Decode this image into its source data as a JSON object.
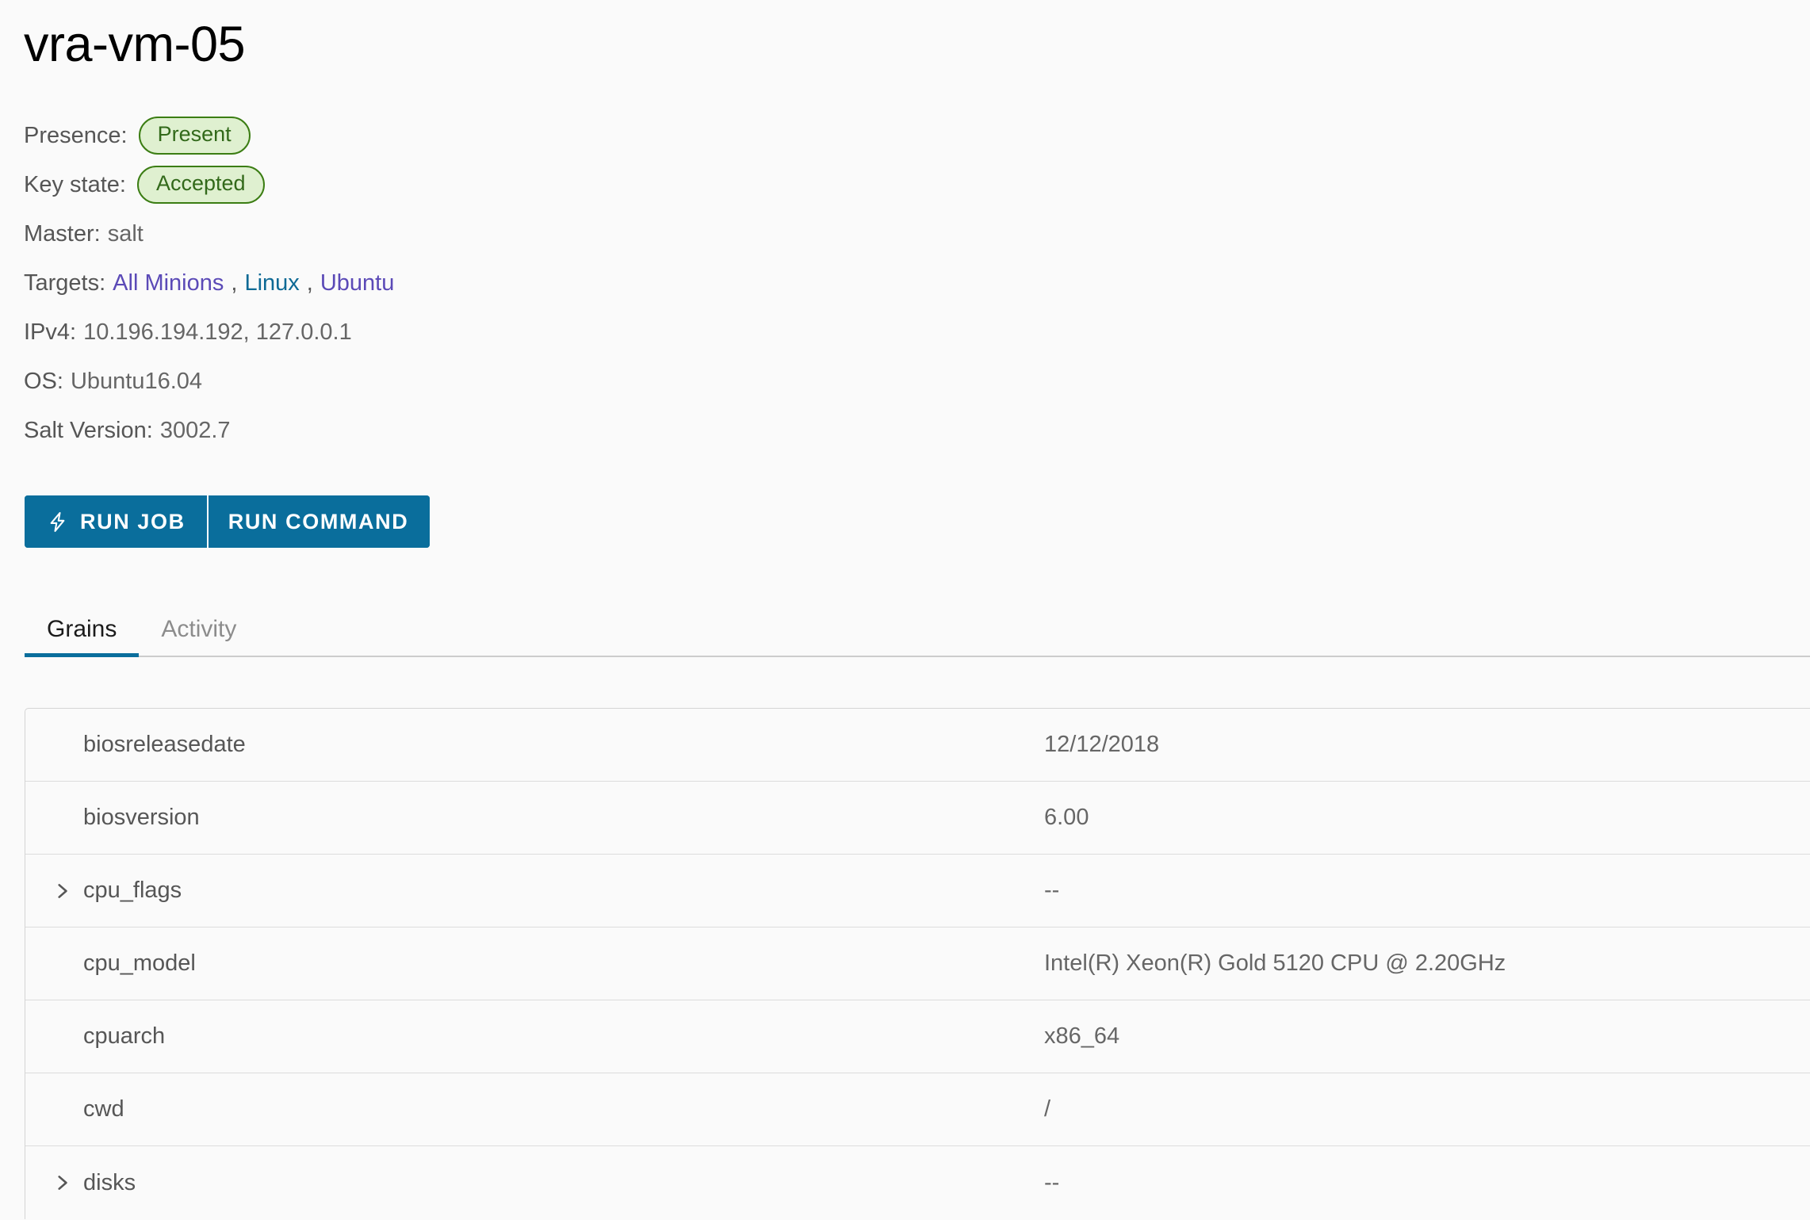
{
  "header": {
    "title": "vra-vm-05"
  },
  "meta": {
    "presence": {
      "label": "Presence:",
      "value": "Present"
    },
    "key_state": {
      "label": "Key state:",
      "value": "Accepted"
    },
    "master": {
      "label": "Master:",
      "value": "salt"
    },
    "targets": {
      "label": "Targets:",
      "items": [
        "All Minions",
        "Linux",
        "Ubuntu"
      ],
      "separator": ","
    },
    "ipv4": {
      "label": "IPv4:",
      "value": "10.196.194.192, 127.0.0.1"
    },
    "os": {
      "label": "OS:",
      "value": "Ubuntu16.04"
    },
    "salt_version": {
      "label": "Salt Version:",
      "value": "3002.7"
    }
  },
  "actions": {
    "run_job": "RUN JOB",
    "run_command": "RUN COMMAND",
    "run_job_icon": "lightning-bolt-icon"
  },
  "tabs": [
    {
      "label": "Grains",
      "active": true
    },
    {
      "label": "Activity",
      "active": false
    }
  ],
  "grains": {
    "rows": [
      {
        "key": "biosreleasedate",
        "value": "12/12/2018",
        "expandable": false
      },
      {
        "key": "biosversion",
        "value": "6.00",
        "expandable": false
      },
      {
        "key": "cpu_flags",
        "value": "--",
        "expandable": true
      },
      {
        "key": "cpu_model",
        "value": "Intel(R) Xeon(R) Gold 5120 CPU @ 2.20GHz",
        "expandable": false
      },
      {
        "key": "cpuarch",
        "value": "x86_64",
        "expandable": false
      },
      {
        "key": "cwd",
        "value": "/",
        "expandable": false
      },
      {
        "key": "disks",
        "value": "--",
        "expandable": true
      }
    ]
  },
  "colors": {
    "accent": "#0a6e9c",
    "badge_bg": "#dff0d0",
    "badge_border": "#3b7d13",
    "badge_text": "#32691a",
    "link": "#5b4ab7",
    "link_alt": "#0f6a95",
    "page_bg": "#fafafa",
    "text": "#565656"
  }
}
